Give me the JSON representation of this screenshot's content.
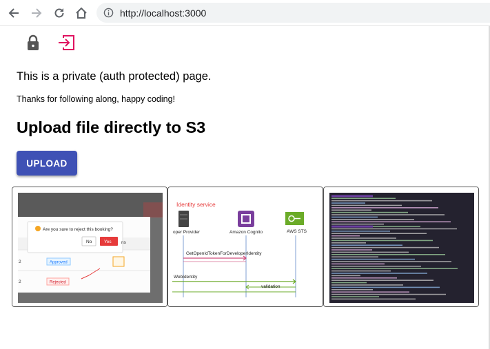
{
  "browser": {
    "url": "http://localhost:3000"
  },
  "page": {
    "private_text": "This is a private (auth protected) page.",
    "thanks_text": "Thanks for following along, happy coding!",
    "heading": "Upload file directly to S3",
    "upload_label": "UPLOAD"
  },
  "icons": {
    "lock": "lock-icon",
    "logout": "logout-icon"
  },
  "thumbnails": [
    {
      "dialog_text": "Are you sure to reject this booking?",
      "no_label": "No",
      "yes_label": "Yes",
      "partial_header": "ns",
      "approved_badge": "Approved",
      "rejected_badge": "Rejected",
      "row1_num": "2",
      "row2_num": "2"
    },
    {
      "title": "Identity service",
      "provider_label": "oper Provider",
      "cognito_label": "Amazon Cognito",
      "sts_label": "AWS STS",
      "token_label": "GetOpenIdTokenForDeveloperIdentity",
      "webid_label": "WebIdentity",
      "validation_label": "validation"
    },
    {
      "description": "terminal output"
    }
  ],
  "colors": {
    "primary": "#3f51b5",
    "accent_pink": "#e0115f",
    "thumb_red": "#e63b3b"
  }
}
